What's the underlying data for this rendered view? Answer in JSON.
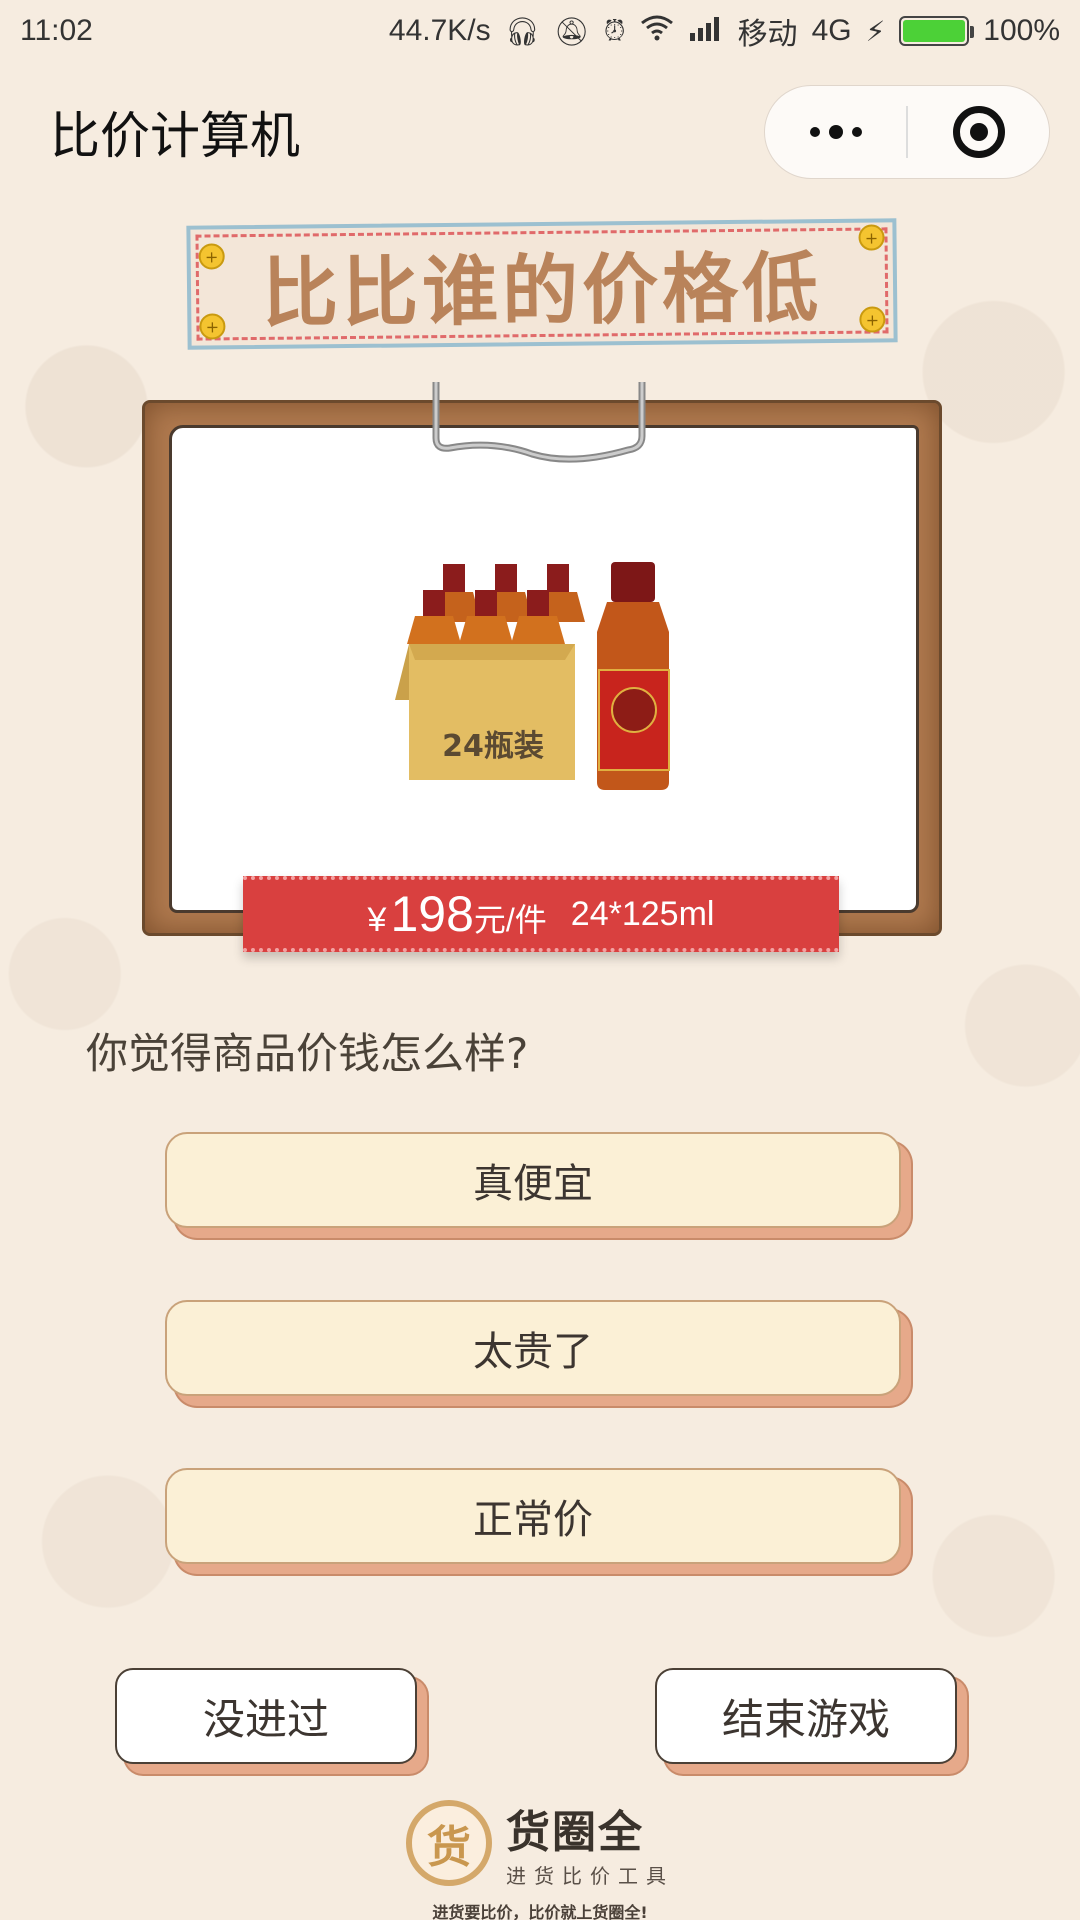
{
  "status_bar": {
    "time": "11:02",
    "network_speed": "44.7K/s",
    "carrier": "移动",
    "network_type": "4G",
    "battery": "100%",
    "icons": [
      "headphone-icon",
      "mute-icon",
      "alarm-icon",
      "wifi-icon",
      "signal-icon",
      "charging-icon",
      "battery-icon"
    ]
  },
  "nav": {
    "title": "比价计算机",
    "more_icon": "more-dots-icon",
    "close_icon": "target-ring-icon"
  },
  "banner": {
    "title": "比比谁的价格低"
  },
  "product": {
    "image_label": "24瓶装",
    "price_currency": "¥",
    "price_value": "198",
    "price_unit": "元/件",
    "spec": "24*125ml"
  },
  "question": "你觉得商品价钱怎么样?",
  "options": [
    {
      "label": "真便宜"
    },
    {
      "label": "太贵了"
    },
    {
      "label": "正常价"
    }
  ],
  "actions": {
    "not_bought_label": "没进过",
    "end_game_label": "结束游戏"
  },
  "footer": {
    "logo_glyph": "货",
    "brand_name": "货圈全",
    "brand_sub": "进货比价工具",
    "slogan": "进货要比价，比价就上货圈全!"
  },
  "colors": {
    "background": "#f6ece0",
    "title_text": "#b9835a",
    "price_tag": "#d9403f",
    "option_bg": "#fbf0d6",
    "option_shadow": "#e6a98a"
  }
}
